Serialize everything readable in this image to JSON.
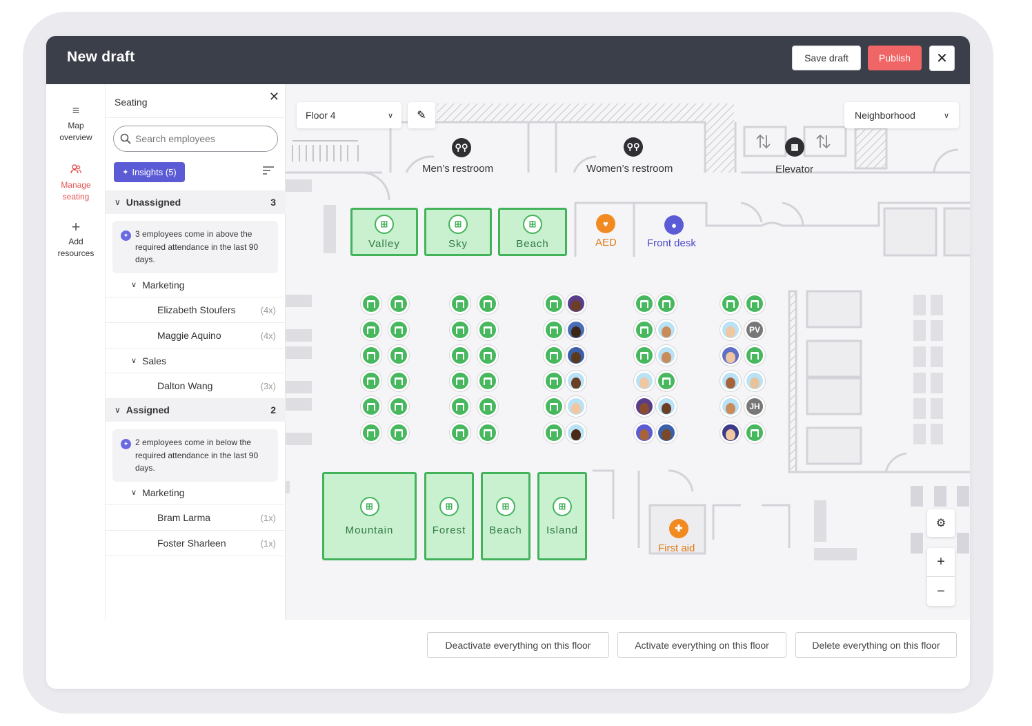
{
  "header": {
    "title": "New draft",
    "save_label": "Save draft",
    "publish_label": "Publish",
    "close_glyph": "✕"
  },
  "nav": {
    "items": [
      {
        "label1": "Map",
        "label2": "overview",
        "icon": "menu-icon"
      },
      {
        "label1": "Manage",
        "label2": "seating",
        "icon": "people-icon"
      },
      {
        "label1": "Add",
        "label2": "resources",
        "icon": "plus-icon"
      }
    ]
  },
  "panel": {
    "title": "Seating",
    "search_placeholder": "Search employees",
    "insights_label": "Insights (5)",
    "unassigned": {
      "label": "Unassigned",
      "count": "3",
      "info": "3 employees come in above the required attendance in the last 90 days.",
      "groups": [
        {
          "name": "Marketing",
          "employees": [
            {
              "name": "Elizabeth Stoufers",
              "count": "(4x)"
            },
            {
              "name": "Maggie Aquino",
              "count": "(4x)"
            }
          ]
        },
        {
          "name": "Sales",
          "employees": [
            {
              "name": "Dalton Wang",
              "count": "(3x)"
            }
          ]
        }
      ]
    },
    "assigned": {
      "label": "Assigned",
      "count": "2",
      "info": "2 employees come in below the required attendance in the last 90 days.",
      "groups": [
        {
          "name": "Marketing",
          "employees": [
            {
              "name": "Bram Larma",
              "count": "(1x)"
            },
            {
              "name": "Foster Sharleen",
              "count": "(1x)"
            }
          ]
        }
      ]
    }
  },
  "map": {
    "floor": "Floor 4",
    "neighborhood": "Neighborhood",
    "labels": {
      "mens": "Men’s restroom",
      "womens": "Women’s restroom",
      "elevator": "Elevator",
      "aed": "AED",
      "front_desk": "Front desk",
      "first_aid": "First aid"
    },
    "rooms_top": [
      "Valley",
      "Sky",
      "Beach"
    ],
    "rooms_bottom": [
      "Mountain",
      "Forest",
      "Beach",
      "Island"
    ],
    "initials": [
      "PV",
      "JH"
    ],
    "colors": {
      "desk": "#48b85f",
      "room_fill": "#c9f0cf",
      "room_border": "#43b35b",
      "aed": "#f28a22",
      "front_desk": "#5b5bd6",
      "publish": "#f06565"
    }
  },
  "footer": {
    "deactivate": "Deactivate everything on this floor",
    "activate": "Activate everything on this floor",
    "delete": "Delete everything on this floor"
  }
}
